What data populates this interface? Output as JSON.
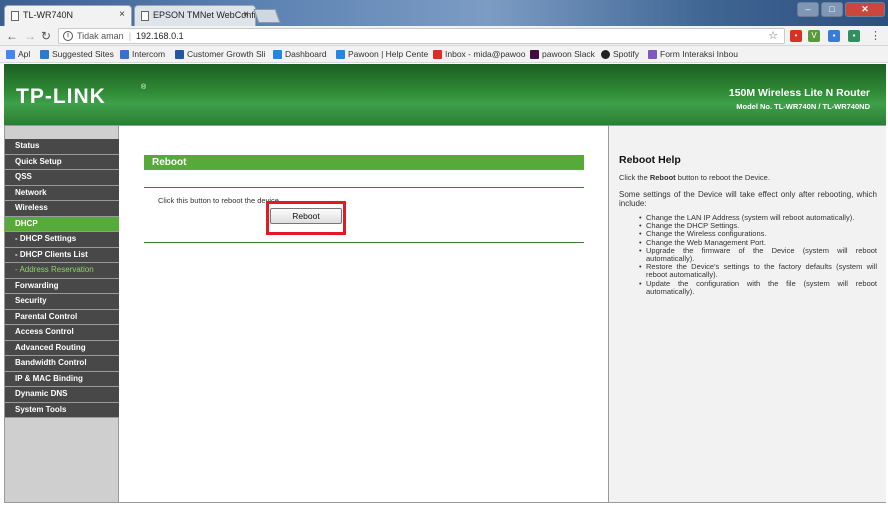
{
  "browser": {
    "tabs": [
      {
        "title": "TL-WR740N",
        "active": true
      },
      {
        "title": "EPSON TMNet WebConfi",
        "active": false
      }
    ],
    "address": {
      "security_label": "Tidak aman",
      "url": "192.168.0.1"
    },
    "bookmarks": [
      {
        "label": "Apl",
        "color": "#4285f4"
      },
      {
        "label": "Suggested Sites",
        "color": "#2b7bd3"
      },
      {
        "label": "Intercom",
        "color": "#3a6fd8"
      },
      {
        "label": "Customer Growth Sli",
        "color": "#2356a8"
      },
      {
        "label": "Dashboard",
        "color": "#1e88e5"
      },
      {
        "label": "Pawoon | Help Cente",
        "color": "#1e88e5"
      },
      {
        "label": "Inbox - mida@pawoo",
        "color": "#d93025"
      },
      {
        "label": "pawoon Slack",
        "color": "#3f0e40"
      },
      {
        "label": "Spotify",
        "color": "#222222"
      },
      {
        "label": "Form Interaksi Inbou",
        "color": "#7e57c2"
      }
    ]
  },
  "router": {
    "brand": "TP-LINK",
    "model_name": "150M Wireless Lite N Router",
    "model_no": "Model No. TL-WR740N / TL-WR740ND",
    "menu": [
      {
        "label": "Status",
        "type": "main"
      },
      {
        "label": "Quick Setup",
        "type": "main"
      },
      {
        "label": "QSS",
        "type": "main"
      },
      {
        "label": "Network",
        "type": "main"
      },
      {
        "label": "Wireless",
        "type": "main"
      },
      {
        "label": "DHCP",
        "type": "active"
      },
      {
        "label": "- DHCP Settings",
        "type": "sub"
      },
      {
        "label": "- DHCP Clients List",
        "type": "sub"
      },
      {
        "label": "- Address Reservation",
        "type": "current"
      },
      {
        "label": "Forwarding",
        "type": "main"
      },
      {
        "label": "Security",
        "type": "main"
      },
      {
        "label": "Parental Control",
        "type": "main"
      },
      {
        "label": "Access Control",
        "type": "main"
      },
      {
        "label": "Advanced Routing",
        "type": "main"
      },
      {
        "label": "Bandwidth Control",
        "type": "main"
      },
      {
        "label": "IP & MAC Binding",
        "type": "main"
      },
      {
        "label": "Dynamic DNS",
        "type": "main"
      },
      {
        "label": "System Tools",
        "type": "main"
      }
    ],
    "main": {
      "heading": "Reboot",
      "instruction": "Click this button to reboot the device.",
      "button_label": "Reboot"
    },
    "help": {
      "title": "Reboot Help",
      "intro_prefix": "Click the ",
      "intro_bold": "Reboot",
      "intro_suffix": " button to reboot the Device.",
      "paragraph": "Some settings of the Device will take effect only after rebooting, which include:",
      "items": [
        "Change the LAN IP Address (system will reboot automatically).",
        "Change the DHCP Settings.",
        "Change the Wireless configurations.",
        "Change the Web Management Port.",
        "Upgrade the firmware of the Device (system will reboot automatically).",
        "Restore the Device's settings to the factory defaults (system will reboot automatically).",
        "Update the configuration with the file (system will reboot automatically)."
      ]
    }
  }
}
